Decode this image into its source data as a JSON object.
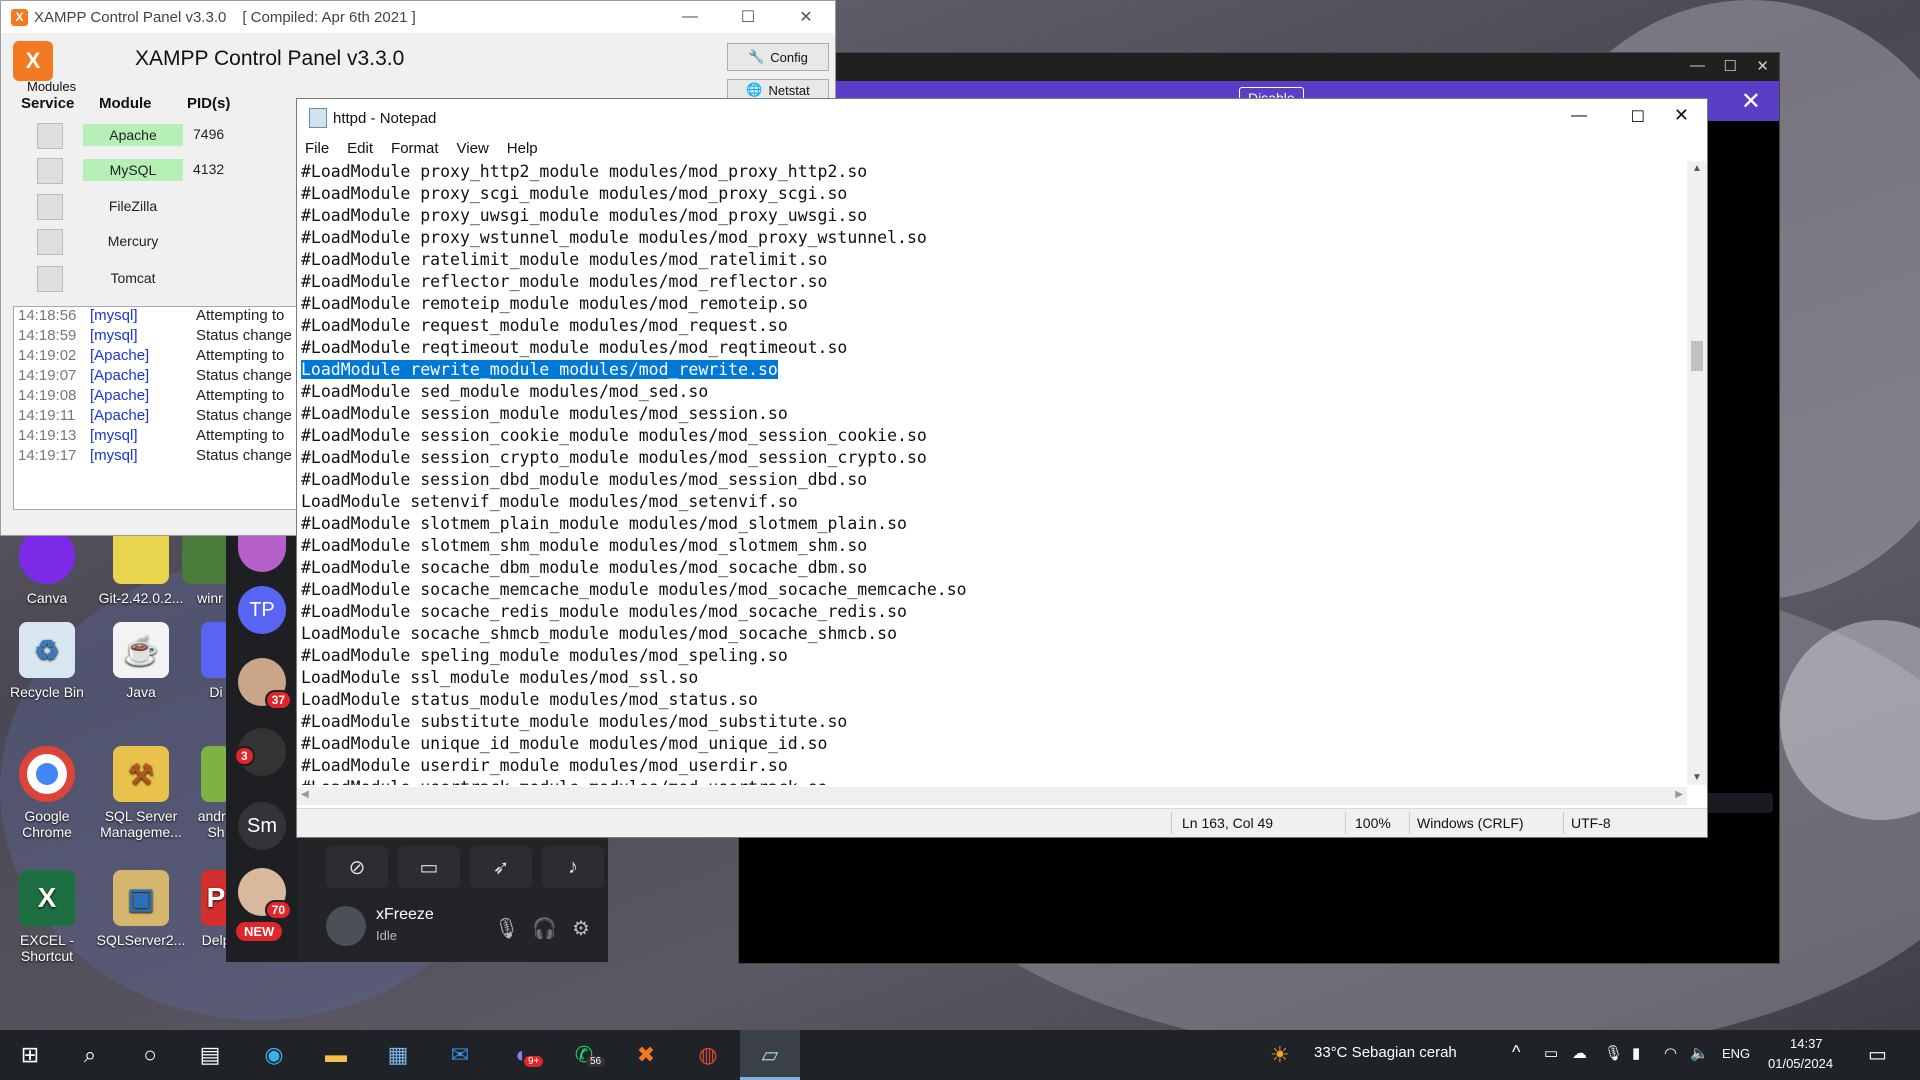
{
  "xampp": {
    "title": "XAMPP Control Panel v3.3.0",
    "compiled": "[ Compiled: Apr 6th 2021 ]",
    "heading": "XAMPP Control Panel v3.3.0",
    "modules_label": "Modules",
    "columns": {
      "service": "Service",
      "module": "Module",
      "pid": "PID(s)"
    },
    "buttons": {
      "config": "Config",
      "netstat": "Netstat"
    },
    "modules": [
      {
        "name": "Apache",
        "pid": "7496",
        "running": true
      },
      {
        "name": "MySQL",
        "pid": "4132",
        "running": true
      },
      {
        "name": "FileZilla",
        "pid": "",
        "running": false
      },
      {
        "name": "Mercury",
        "pid": "",
        "running": false
      },
      {
        "name": "Tomcat",
        "pid": "",
        "running": false
      }
    ],
    "log": [
      {
        "time": "14:18:56",
        "module": "[mysql]",
        "msg": "Attempting to"
      },
      {
        "time": "14:18:59",
        "module": "[mysql]",
        "msg": "Status change"
      },
      {
        "time": "14:19:02",
        "module": "[Apache]",
        "msg": "Attempting to"
      },
      {
        "time": "14:19:07",
        "module": "[Apache]",
        "msg": "Status change"
      },
      {
        "time": "14:19:08",
        "module": "[Apache]",
        "msg": "Attempting to"
      },
      {
        "time": "14:19:11",
        "module": "[Apache]",
        "msg": "Status change"
      },
      {
        "time": "14:19:13",
        "module": "[mysql]",
        "msg": "Attempting to"
      },
      {
        "time": "14:19:17",
        "module": "[mysql]",
        "msg": "Status change"
      }
    ]
  },
  "notepad": {
    "title": "httpd - Notepad",
    "menu": [
      "File",
      "Edit",
      "Format",
      "View",
      "Help"
    ],
    "lines": [
      "#LoadModule proxy_http2_module modules/mod_proxy_http2.so",
      "#LoadModule proxy_scgi_module modules/mod_proxy_scgi.so",
      "#LoadModule proxy_uwsgi_module modules/mod_proxy_uwsgi.so",
      "#LoadModule proxy_wstunnel_module modules/mod_proxy_wstunnel.so",
      "#LoadModule ratelimit_module modules/mod_ratelimit.so",
      "#LoadModule reflector_module modules/mod_reflector.so",
      "#LoadModule remoteip_module modules/mod_remoteip.so",
      "#LoadModule request_module modules/mod_request.so",
      "#LoadModule reqtimeout_module modules/mod_reqtimeout.so",
      "LoadModule rewrite_module modules/mod_rewrite.so",
      "#LoadModule sed_module modules/mod_sed.so",
      "#LoadModule session_module modules/mod_session.so",
      "#LoadModule session_cookie_module modules/mod_session_cookie.so",
      "#LoadModule session_crypto_module modules/mod_session_crypto.so",
      "#LoadModule session_dbd_module modules/mod_session_dbd.so",
      "LoadModule setenvif_module modules/mod_setenvif.so",
      "#LoadModule slotmem_plain_module modules/mod_slotmem_plain.so",
      "#LoadModule slotmem_shm_module modules/mod_slotmem_shm.so",
      "#LoadModule socache_dbm_module modules/mod_socache_dbm.so",
      "#LoadModule socache_memcache_module modules/mod_socache_memcache.so",
      "#LoadModule socache_redis_module modules/mod_socache_redis.so",
      "LoadModule socache_shmcb_module modules/mod_socache_shmcb.so",
      "#LoadModule speling_module modules/mod_speling.so",
      "LoadModule ssl_module modules/mod_ssl.so",
      "LoadModule status_module modules/mod_status.so",
      "#LoadModule substitute_module modules/mod_substitute.so",
      "#LoadModule unique_id_module modules/mod_unique_id.so",
      "#LoadModule userdir_module modules/mod_userdir.so",
      "#LoadModule usertrack_module modules/mod_usertrack.so"
    ],
    "selected_line": 9,
    "status": {
      "position": "Ln 163, Col 49",
      "zoom": "100%",
      "eol": "Windows (CRLF)",
      "encoding": "UTF-8"
    }
  },
  "discord": {
    "banner_partial": "Disable",
    "user": {
      "name": "xFreeze",
      "status": "Idle"
    },
    "servers": [
      {
        "label": "TP",
        "badge": ""
      },
      {
        "label": "",
        "badge": "37"
      },
      {
        "label": "",
        "badge": "3"
      },
      {
        "label": "Sm",
        "badge": ""
      },
      {
        "label": "",
        "badge": "70"
      }
    ],
    "new_label": "NEW"
  },
  "desktop_icons": [
    {
      "label": "Canva"
    },
    {
      "label": "Git-2.42.0.2..."
    },
    {
      "label": "winr"
    },
    {
      "label": "Recycle Bin"
    },
    {
      "label": "Java"
    },
    {
      "label": "Di"
    },
    {
      "label": "Google Chrome"
    },
    {
      "label": "SQL Server Manageme..."
    },
    {
      "label": "andr - Sh"
    },
    {
      "label": "EXCEL - Shortcut"
    },
    {
      "label": "SQLServer2..."
    },
    {
      "label": "Delp"
    }
  ],
  "taskbar": {
    "weather": "33°C  Sebagian cerah",
    "lang": "ENG",
    "time": "14:37",
    "date": "01/05/2024",
    "badges": {
      "discord": "9+",
      "whatsapp": "56"
    }
  }
}
